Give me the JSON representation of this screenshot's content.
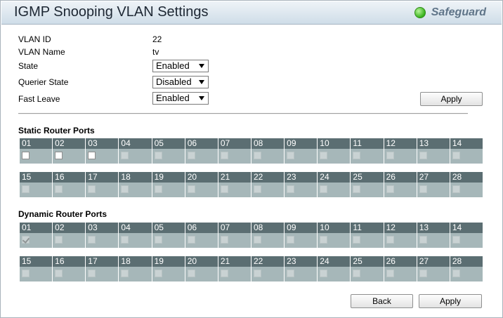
{
  "title": "IGMP Snooping VLAN Settings",
  "safeguard": "Safeguard",
  "fields": {
    "vlan_id_label": "VLAN ID",
    "vlan_id_value": "22",
    "vlan_name_label": "VLAN Name",
    "vlan_name_value": "tv",
    "state_label": "State",
    "state_value": "Enabled",
    "querier_label": "Querier State",
    "querier_value": "Disabled",
    "fast_leave_label": "Fast Leave",
    "fast_leave_value": "Enabled"
  },
  "apply_top": "Apply",
  "static": {
    "title": "Static Router Ports",
    "ports_row1": [
      "01",
      "02",
      "03",
      "04",
      "05",
      "06",
      "07",
      "08",
      "09",
      "10",
      "11",
      "12",
      "13",
      "14"
    ],
    "ports_row2": [
      "15",
      "16",
      "17",
      "18",
      "19",
      "20",
      "21",
      "22",
      "23",
      "24",
      "25",
      "26",
      "27",
      "28"
    ],
    "enabled_ports": [
      "01",
      "02",
      "03"
    ],
    "checked_ports": []
  },
  "dynamic": {
    "title": "Dynamic Router Ports",
    "ports_row1": [
      "01",
      "02",
      "03",
      "04",
      "05",
      "06",
      "07",
      "08",
      "09",
      "10",
      "11",
      "12",
      "13",
      "14"
    ],
    "ports_row2": [
      "15",
      "16",
      "17",
      "18",
      "19",
      "20",
      "21",
      "22",
      "23",
      "24",
      "25",
      "26",
      "27",
      "28"
    ],
    "enabled_ports": [],
    "checked_ports": [
      "01"
    ]
  },
  "back_button": "Back",
  "apply_bottom": "Apply"
}
